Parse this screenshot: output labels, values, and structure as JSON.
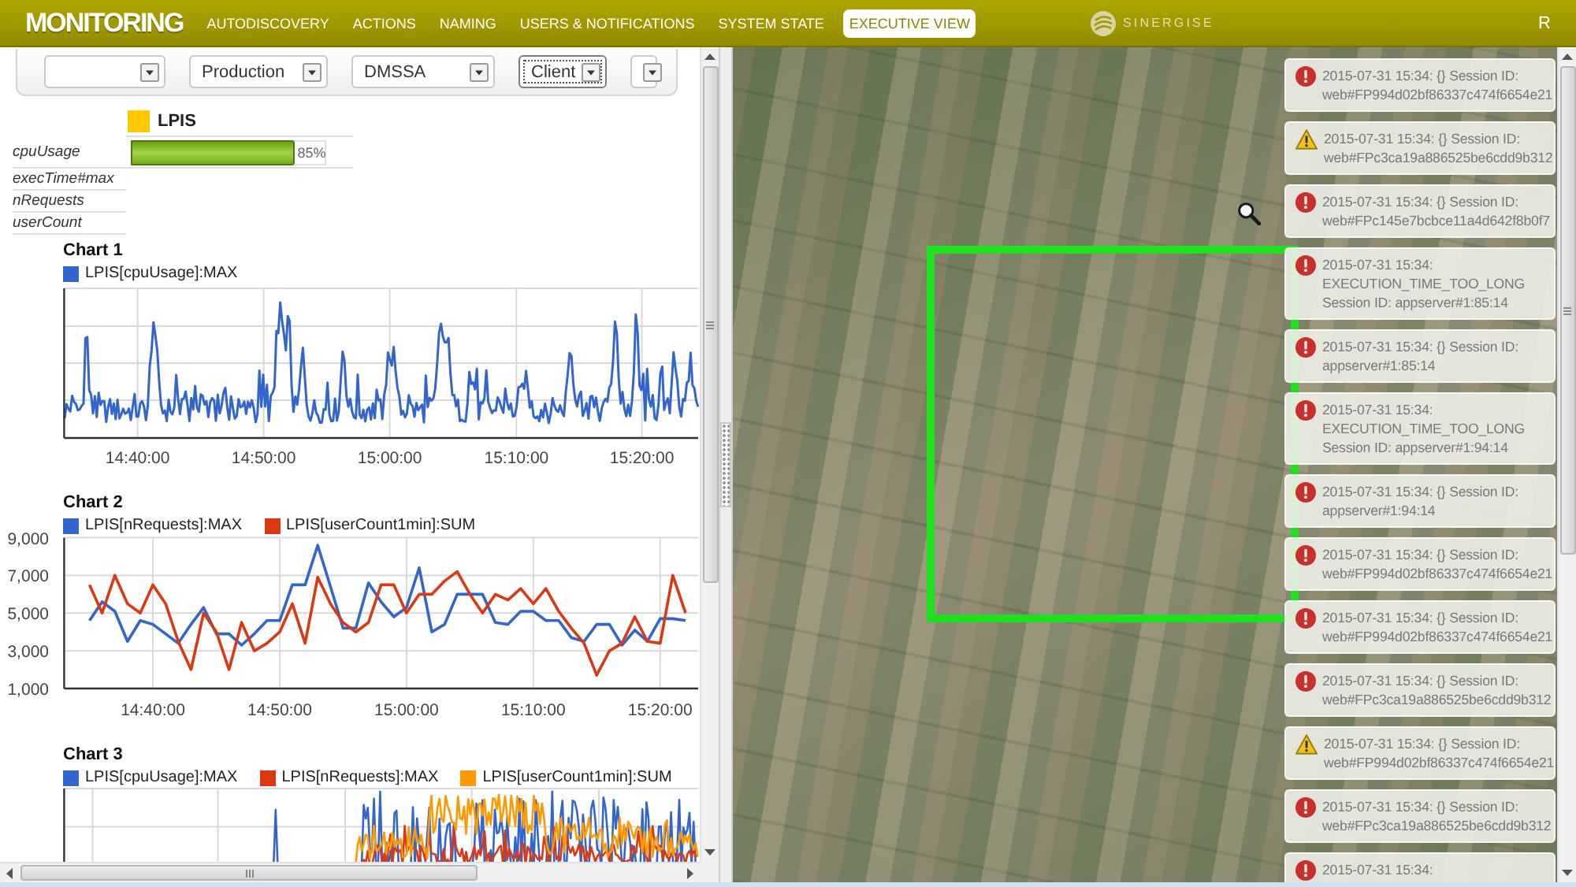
{
  "header": {
    "logo": "MONITORING",
    "nav": [
      {
        "label": "AUTODISCOVERY",
        "selected": false
      },
      {
        "label": "ACTIONS",
        "selected": false
      },
      {
        "label": "NAMING",
        "selected": false
      },
      {
        "label": "USERS & NOTIFICATIONS",
        "selected": false
      },
      {
        "label": "SYSTEM STATE",
        "selected": false
      },
      {
        "label": "EXECUTIVE VIEW",
        "selected": true
      }
    ],
    "brand": "SINERGISE",
    "user": "R"
  },
  "filters": [
    {
      "focused": false
    },
    {
      "value": "Production",
      "focused": false
    },
    {
      "value": "DMSSA",
      "focused": false
    },
    {
      "value": "Client",
      "focused": true
    },
    {
      "focused": false
    }
  ],
  "metrics_table": {
    "app": {
      "name": "LPIS",
      "color": "#ffc800"
    },
    "rows": [
      {
        "name": "cpuUsage",
        "level": 0.85,
        "reading": "85%"
      },
      {
        "name": "execTime#max"
      },
      {
        "name": "nRequests"
      },
      {
        "name": "userCount"
      }
    ]
  },
  "charts": [
    {
      "kind": "trace",
      "title": "Chart 1",
      "legend": [
        {
          "name": "LPIS[cpuUsage]:MAX",
          "color": "#3366cc"
        }
      ],
      "x_tick_labels": [
        "14:40:00",
        "14:50:00",
        "15:00:00",
        "15:10:00",
        "15:20:00"
      ]
    },
    {
      "kind": "plot",
      "chart_data": {
        "type": "line",
        "title": "Chart 2",
        "legend": "top",
        "grid": true,
        "categories": [
          null,
          null,
          null,
          null,
          null,
          "14:40:00",
          null,
          null,
          null,
          null,
          null,
          null,
          null,
          null,
          null,
          "14:50:00",
          null,
          null,
          null,
          null,
          null,
          null,
          null,
          null,
          null,
          "15:00:00",
          null,
          null,
          null,
          null,
          null,
          null,
          null,
          null,
          null,
          "15:10:00",
          null,
          null,
          null,
          null,
          null,
          null,
          null,
          null,
          null,
          "15:20:00",
          null,
          null
        ],
        "series": [
          {
            "name": "LPIS[nRequests]:MAX",
            "color": "#3366cc",
            "values": [
              4600,
              5600,
              5100,
              3500,
              4600,
              4400,
              3900,
              3400,
              4400,
              5300,
              3900,
              3900,
              3300,
              3900,
              4600,
              4600,
              6500,
              6500,
              8600,
              6400,
              4200,
              4200,
              6600,
              5600,
              4800,
              5300,
              7400,
              4000,
              4400,
              6000,
              6000,
              6000,
              4500,
              4400,
              5100,
              5100,
              4600,
              4600,
              3700,
              3500,
              4400,
              4400,
              3300,
              4100,
              3500,
              4700,
              4700,
              4600
            ]
          },
          {
            "name": "LPIS[userCount1min]:SUM",
            "color": "#dc3912",
            "values": [
              6500,
              5000,
              7000,
              5500,
              5000,
              6500,
              5500,
              3500,
              2000,
              5000,
              4000,
              2000,
              4500,
              3000,
              3400,
              4000,
              5500,
              3400,
              6900,
              5500,
              4500,
              4000,
              4500,
              6500,
              6500,
              5000,
              6000,
              6000,
              6700,
              7200,
              6000,
              5000,
              6000,
              5700,
              6300,
              5500,
              6300,
              5100,
              4200,
              3400,
              1700,
              3000,
              3400,
              4800,
              3500,
              3400,
              7000,
              5000
            ]
          }
        ],
        "ylim": [
          1000,
          9000
        ],
        "yticks": [
          {
            "value": 1000,
            "label": "1,000"
          },
          {
            "value": 3000,
            "label": "3,000"
          },
          {
            "value": 5000,
            "label": "5,000"
          },
          {
            "value": 7000,
            "label": "7,000"
          },
          {
            "value": 9000,
            "label": "9,000"
          }
        ]
      }
    },
    {
      "kind": "trace",
      "title": "Chart 3",
      "legend": [
        {
          "name": "LPIS[cpuUsage]:MAX",
          "color": "#3366cc"
        },
        {
          "name": "LPIS[nRequests]:MAX",
          "color": "#dc3912"
        },
        {
          "name": "LPIS[userCount1min]:SUM",
          "color": "#ff9900"
        }
      ]
    }
  ],
  "notifications": [
    {
      "kind": "error",
      "text": "2015-07-31 15:34: {} Session ID: web#FP994d02bf86337c474f6654e21"
    },
    {
      "kind": "warning",
      "text": "2015-07-31 15:34: {} Session ID: web#FPc3ca19a886525be6cdd9b312"
    },
    {
      "kind": "error",
      "text": "2015-07-31 15:34: {} Session ID: web#FPc145e7bcbce11a4d642f8b0f7"
    },
    {
      "kind": "error",
      "text": "2015-07-31 15:34: EXECUTION_TIME_TOO_LONG Session ID: appserver#1:85:14"
    },
    {
      "kind": "error",
      "text": "2015-07-31 15:34: {} Session ID: appserver#1:85:14"
    },
    {
      "kind": "error",
      "text": "2015-07-31 15:34: EXECUTION_TIME_TOO_LONG Session ID: appserver#1:94:14"
    },
    {
      "kind": "error",
      "text": "2015-07-31 15:34: {} Session ID: appserver#1:94:14"
    },
    {
      "kind": "error",
      "text": "2015-07-31 15:34: {} Session ID: web#FP994d02bf86337c474f6654e21"
    },
    {
      "kind": "error",
      "text": "2015-07-31 15:34: {} Session ID: web#FP994d02bf86337c474f6654e21"
    },
    {
      "kind": "error",
      "text": "2015-07-31 15:34: {} Session ID: web#FPc3ca19a886525be6cdd9b312"
    },
    {
      "kind": "warning",
      "text": "2015-07-31 15:34: {} Session ID: web#FP994d02bf86337c474f6654e21"
    },
    {
      "kind": "error",
      "text": "2015-07-31 15:34: {} Session ID: web#FPc3ca19a886525be6cdd9b312"
    },
    {
      "kind": "error",
      "text": "2015-07-31 15:34:"
    }
  ]
}
